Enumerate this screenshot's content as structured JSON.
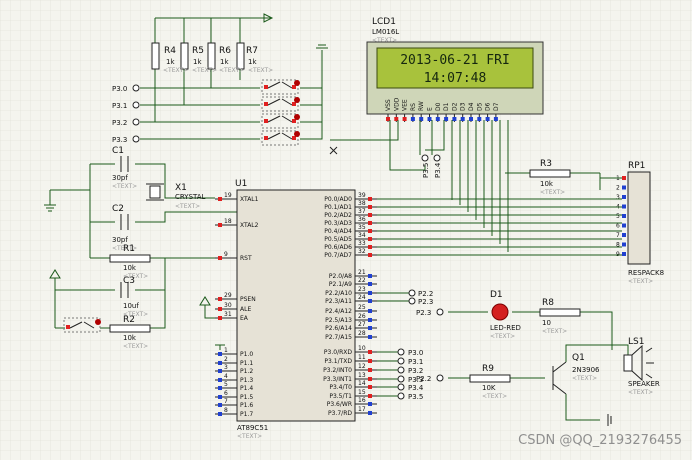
{
  "lcd": {
    "ref": "LCD1",
    "model": "LM016L",
    "text_tag": "<TEXT>",
    "line1": "2013-06-21 FRI",
    "line2": "14:07:48",
    "pins": [
      "VSS",
      "VDD",
      "VEE",
      "RS",
      "RW",
      "E",
      "D0",
      "D1",
      "D2",
      "D3",
      "D4",
      "D5",
      "D6",
      "D7"
    ]
  },
  "resistors_top": [
    {
      "ref": "R4",
      "value": "1k"
    },
    {
      "ref": "R5",
      "value": "1k"
    },
    {
      "ref": "R6",
      "value": "1k"
    },
    {
      "ref": "R7",
      "value": "1k"
    }
  ],
  "button_ports": [
    "P3.0",
    "P3.1",
    "P3.2",
    "P3.3"
  ],
  "lcd_ports": [
    "P3.5",
    "P3.4"
  ],
  "crystal": {
    "c1_ref": "C1",
    "c1_value": "30pf",
    "c2_ref": "C2",
    "c2_value": "30pf",
    "x_ref": "X1",
    "x_value": "CRYSTAL"
  },
  "reset": {
    "r1_ref": "R1",
    "r1_value": "10k",
    "c3_ref": "C3",
    "c3_value": "10uf",
    "r2_ref": "R2",
    "r2_value": "10k"
  },
  "mcu": {
    "ref": "U1",
    "model": "AT89C51",
    "left_pins": [
      {
        "num": "19",
        "name": "XTAL1"
      },
      {
        "num": "18",
        "name": "XTAL2"
      },
      {
        "num": "9",
        "name": "RST"
      },
      {
        "num": "29",
        "name": "PSEN"
      },
      {
        "num": "30",
        "name": "ALE"
      },
      {
        "num": "31",
        "name": "EA"
      },
      {
        "num": "1",
        "name": "P1.0"
      },
      {
        "num": "2",
        "name": "P1.1"
      },
      {
        "num": "3",
        "name": "P1.2"
      },
      {
        "num": "4",
        "name": "P1.3"
      },
      {
        "num": "5",
        "name": "P1.4"
      },
      {
        "num": "6",
        "name": "P1.5"
      },
      {
        "num": "7",
        "name": "P1.6"
      },
      {
        "num": "8",
        "name": "P1.7"
      }
    ],
    "right_pins": [
      {
        "num": "39",
        "name": "P0.0/AD0"
      },
      {
        "num": "38",
        "name": "P0.1/AD1"
      },
      {
        "num": "37",
        "name": "P0.2/AD2"
      },
      {
        "num": "36",
        "name": "P0.3/AD3"
      },
      {
        "num": "35",
        "name": "P0.4/AD4"
      },
      {
        "num": "34",
        "name": "P0.5/AD5"
      },
      {
        "num": "33",
        "name": "P0.6/AD6"
      },
      {
        "num": "32",
        "name": "P0.7/AD7"
      },
      {
        "num": "21",
        "name": "P2.0/A8"
      },
      {
        "num": "22",
        "name": "P2.1/A9"
      },
      {
        "num": "23",
        "name": "P2.2/A10"
      },
      {
        "num": "24",
        "name": "P2.3/A11"
      },
      {
        "num": "25",
        "name": "P2.4/A12"
      },
      {
        "num": "26",
        "name": "P2.5/A13"
      },
      {
        "num": "27",
        "name": "P2.6/A14"
      },
      {
        "num": "28",
        "name": "P2.7/A15"
      },
      {
        "num": "10",
        "name": "P3.0/RXD"
      },
      {
        "num": "11",
        "name": "P3.1/TXD"
      },
      {
        "num": "12",
        "name": "P3.2/INT0"
      },
      {
        "num": "13",
        "name": "P3.3/INT1"
      },
      {
        "num": "14",
        "name": "P3.4/T0"
      },
      {
        "num": "15",
        "name": "P3.5/T1"
      },
      {
        "num": "16",
        "name": "P3.6/WR"
      },
      {
        "num": "17",
        "name": "P3.7/RD"
      }
    ],
    "p2_ports": [
      "P2.2",
      "P2.3"
    ],
    "p3_ports": [
      "P3.0",
      "P3.1",
      "P3.2",
      "P3.3",
      "P3.4",
      "P3.5"
    ]
  },
  "r3": {
    "ref": "R3",
    "value": "10k"
  },
  "rp1": {
    "ref": "RP1",
    "model": "RESPACK8",
    "pins": [
      "1",
      "2",
      "3",
      "4",
      "5",
      "6",
      "7",
      "8",
      "9"
    ]
  },
  "led": {
    "ref": "D1",
    "model": "LED-RED",
    "port": "P2.3"
  },
  "r8": {
    "ref": "R8",
    "value": "10"
  },
  "r9": {
    "ref": "R9",
    "value": "10K",
    "port": "P2.2"
  },
  "q1": {
    "ref": "Q1",
    "model": "2N3906"
  },
  "ls1": {
    "ref": "LS1",
    "model": "SPEAKER"
  },
  "watermark": "CSDN @QQ_2193276455"
}
